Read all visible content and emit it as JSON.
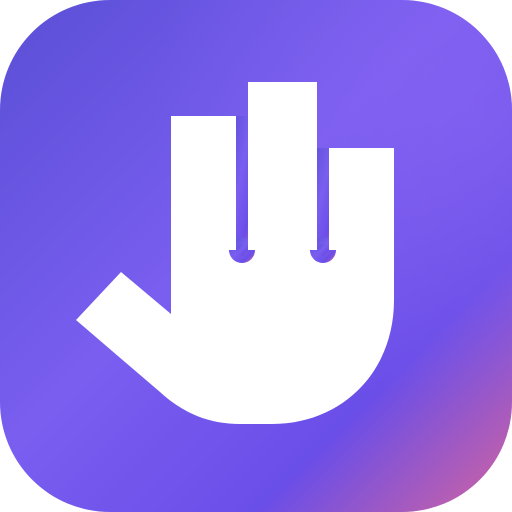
{
  "icon": {
    "name": "hand-icon",
    "colors": {
      "gradient_top_left": "#5a4fd6",
      "gradient_top_right": "#7a5ef0",
      "gradient_middle": "#6a4ee8",
      "gradient_bottom_right": "#d3649f",
      "glyph": "#ffffff"
    }
  }
}
